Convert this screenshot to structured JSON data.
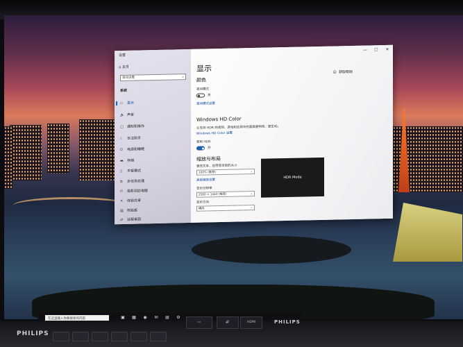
{
  "window": {
    "title": "设置",
    "controls": [
      "—",
      "☐",
      "✕"
    ]
  },
  "sidebar": {
    "home": "主页",
    "search_placeholder": "查找设置",
    "section": "系统",
    "items": [
      {
        "icon": "display-icon",
        "glyph": "▭",
        "label": "显示"
      },
      {
        "icon": "sound-icon",
        "glyph": "🔈",
        "label": "声音"
      },
      {
        "icon": "notifications-icon",
        "glyph": "▢",
        "label": "通知和操作"
      },
      {
        "icon": "focus-assist-icon",
        "glyph": "☾",
        "label": "专注助手"
      },
      {
        "icon": "power-icon",
        "glyph": "⏻",
        "label": "电源和睡眠"
      },
      {
        "icon": "storage-icon",
        "glyph": "▬",
        "label": "存储"
      },
      {
        "icon": "tablet-icon",
        "glyph": "▯",
        "label": "平板模式"
      },
      {
        "icon": "multitasking-icon",
        "glyph": "⧉",
        "label": "多任务处理"
      },
      {
        "icon": "projecting-icon",
        "glyph": "⎚",
        "label": "投影到此电脑"
      },
      {
        "icon": "shared-experiences-icon",
        "glyph": "✕",
        "label": "体验共享"
      },
      {
        "icon": "clipboard-icon",
        "glyph": "▤",
        "label": "剪贴板"
      },
      {
        "icon": "remote-desktop-icon",
        "glyph": "⇄",
        "label": "远程桌面"
      }
    ]
  },
  "main": {
    "title": "显示",
    "help": "获取帮助",
    "color": {
      "heading": "颜色",
      "night_light_label": "夜间模式",
      "night_light_state": "关",
      "night_light_link": "夜间模式设置"
    },
    "hd_color": {
      "heading": "Windows HD Color",
      "description": "让支持 HDR 的视频、游戏和应用中的画面更明亮、更生动。",
      "link": "Windows HD Color 设置",
      "hdr_label": "使用 HDR",
      "hdr_state": "开"
    },
    "layout": {
      "heading": "缩放与布局",
      "scale_label": "更改文本、应用等项目的大小",
      "scale_value": "100% (推荐)",
      "advanced_link": "高级缩放设置",
      "resolution_label": "显示分辨率",
      "resolution_value": "2560 × 1440 (推荐)",
      "orientation_label": "显示方向",
      "orientation_value": "横向"
    },
    "hdr_preview": "HDR Mode"
  },
  "taskbar": {
    "search_placeholder": "在这里输入你要搜索的内容"
  },
  "monitor": {
    "brand": "PHILIPS",
    "osd": [
      "HDMI"
    ]
  },
  "colors": {
    "accent": "#1a5fb0",
    "link": "#0a4aa0"
  }
}
